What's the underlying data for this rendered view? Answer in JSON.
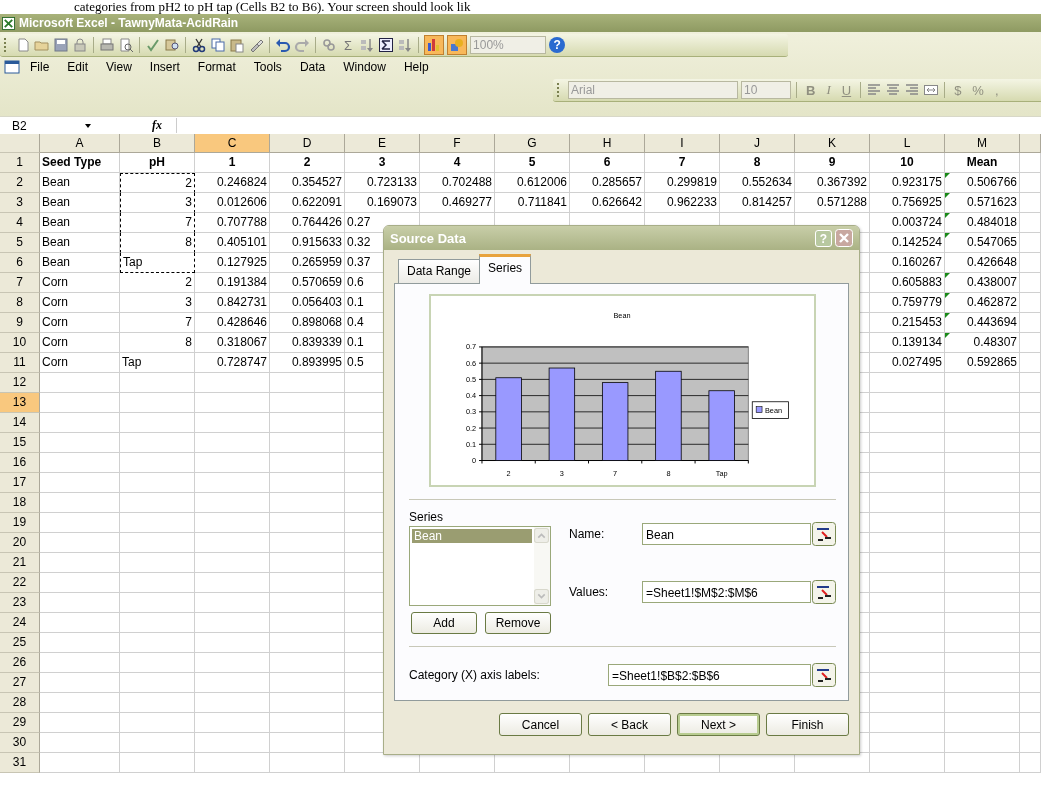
{
  "document_text": "categories from pH2 to pH tap (Cells B2 to B6). Your screen should look lik",
  "window": {
    "title": "Microsoft Excel - TawnyMata-AcidRain"
  },
  "toolbar": {
    "autosum": "Σ",
    "zoom": "100%",
    "help": "?"
  },
  "menu": [
    "File",
    "Edit",
    "View",
    "Insert",
    "Format",
    "Tools",
    "Data",
    "Window",
    "Help"
  ],
  "format_toolbar": {
    "font": "Arial",
    "size": "10",
    "styles": [
      "B",
      "I",
      "U"
    ],
    "number_formats": [
      "$",
      "%",
      ","
    ]
  },
  "formula_bar": {
    "name_box": "B2",
    "fx": "fx"
  },
  "sheet": {
    "columns": [
      {
        "label": "A",
        "selected": false
      },
      {
        "label": "B",
        "selected": false
      },
      {
        "label": "C",
        "selected": true
      },
      {
        "label": "D",
        "selected": false
      },
      {
        "label": "E",
        "selected": false
      },
      {
        "label": "F",
        "selected": false
      },
      {
        "label": "G",
        "selected": false
      },
      {
        "label": "H",
        "selected": false
      },
      {
        "label": "I",
        "selected": false
      },
      {
        "label": "J",
        "selected": false
      },
      {
        "label": "K",
        "selected": false
      },
      {
        "label": "L",
        "selected": false
      },
      {
        "label": "M",
        "selected": false
      }
    ],
    "rows": [
      {
        "number": "1",
        "selected": false,
        "kind": "header",
        "cells": [
          "Seed Type",
          "pH",
          "1",
          "2",
          "3",
          "4",
          "5",
          "6",
          "7",
          "8",
          "9",
          "10",
          "Mean"
        ]
      },
      {
        "number": "2",
        "selected": false,
        "kind": "data",
        "copy_range": true,
        "ph_is_text": false,
        "flag": true,
        "cells": [
          "Bean",
          "2",
          "0.246824",
          "0.354527",
          "0.723133",
          "0.702488",
          "0.612006",
          "0.285657",
          "0.299819",
          "0.552634",
          "0.367392",
          "0.923175",
          "0.506766"
        ]
      },
      {
        "number": "3",
        "selected": false,
        "kind": "data",
        "copy_range": true,
        "ph_is_text": false,
        "flag": true,
        "cells": [
          "Bean",
          "3",
          "0.012606",
          "0.622091",
          "0.169073",
          "0.469277",
          "0.711841",
          "0.626642",
          "0.962233",
          "0.814257",
          "0.571288",
          "0.756925",
          "0.571623"
        ]
      },
      {
        "number": "4",
        "selected": false,
        "kind": "data",
        "copy_range": true,
        "ph_is_text": false,
        "flag": true,
        "cells": [
          "Bean",
          "7",
          "0.707788",
          "0.764426",
          "0.27",
          null,
          null,
          null,
          null,
          null,
          null,
          "0.003724",
          "0.484018"
        ]
      },
      {
        "number": "5",
        "selected": false,
        "kind": "data",
        "copy_range": true,
        "ph_is_text": false,
        "flag": true,
        "cells": [
          "Bean",
          "8",
          "0.405101",
          "0.915633",
          "0.32",
          null,
          null,
          null,
          null,
          null,
          null,
          "0.142524",
          "0.547065"
        ]
      },
      {
        "number": "6",
        "selected": false,
        "kind": "data",
        "copy_range": true,
        "ph_is_text": true,
        "flag": false,
        "cells": [
          "Bean",
          "Tap",
          "0.127925",
          "0.265959",
          "0.37",
          null,
          null,
          null,
          null,
          null,
          null,
          "0.160267",
          "0.426648"
        ]
      },
      {
        "number": "7",
        "selected": false,
        "kind": "data",
        "copy_range": false,
        "ph_is_text": false,
        "flag": true,
        "cells": [
          "Corn",
          "2",
          "0.191384",
          "0.570659",
          "0.6",
          null,
          null,
          null,
          null,
          null,
          null,
          "0.605883",
          "0.438007"
        ]
      },
      {
        "number": "8",
        "selected": false,
        "kind": "data",
        "copy_range": false,
        "ph_is_text": false,
        "flag": true,
        "cells": [
          "Corn",
          "3",
          "0.842731",
          "0.056403",
          "0.1",
          null,
          null,
          null,
          null,
          null,
          null,
          "0.759779",
          "0.462872"
        ]
      },
      {
        "number": "9",
        "selected": false,
        "kind": "data",
        "copy_range": false,
        "ph_is_text": false,
        "flag": true,
        "cells": [
          "Corn",
          "7",
          "0.428646",
          "0.898068",
          "0.4",
          null,
          null,
          null,
          null,
          null,
          null,
          "0.215453",
          "0.443694"
        ]
      },
      {
        "number": "10",
        "selected": false,
        "kind": "data",
        "copy_range": false,
        "ph_is_text": false,
        "flag": true,
        "cells": [
          "Corn",
          "8",
          "0.318067",
          "0.839339",
          "0.1",
          null,
          null,
          null,
          null,
          null,
          null,
          "0.139134",
          "0.48307"
        ]
      },
      {
        "number": "11",
        "selected": false,
        "kind": "data",
        "copy_range": false,
        "ph_is_text": true,
        "flag": false,
        "cells": [
          "Corn",
          "Tap",
          "0.728747",
          "0.893995",
          "0.5",
          null,
          null,
          null,
          null,
          null,
          null,
          "0.027495",
          "0.592865"
        ]
      },
      {
        "number": "12",
        "selected": false
      },
      {
        "number": "13",
        "selected": true
      },
      {
        "number": "14",
        "selected": false
      },
      {
        "number": "15",
        "selected": false
      },
      {
        "number": "16",
        "selected": false
      },
      {
        "number": "17",
        "selected": false
      },
      {
        "number": "18",
        "selected": false
      },
      {
        "number": "19",
        "selected": false
      },
      {
        "number": "20",
        "selected": false
      },
      {
        "number": "21",
        "selected": false
      },
      {
        "number": "22",
        "selected": false
      },
      {
        "number": "23",
        "selected": false
      },
      {
        "number": "24",
        "selected": false
      },
      {
        "number": "25",
        "selected": false
      },
      {
        "number": "26",
        "selected": false
      },
      {
        "number": "27",
        "selected": false
      },
      {
        "number": "28",
        "selected": false
      },
      {
        "number": "29",
        "selected": false
      },
      {
        "number": "30",
        "selected": false
      },
      {
        "number": "31",
        "selected": false
      }
    ]
  },
  "dialog": {
    "title": "Source Data",
    "help": "?",
    "tabs": [
      {
        "label": "Data Range",
        "selected": false
      },
      {
        "label": "Series",
        "selected": true
      }
    ],
    "chart_data": {
      "type": "bar",
      "title": "Bean",
      "categories": [
        "2",
        "3",
        "7",
        "8",
        "Tap"
      ],
      "series": [
        {
          "name": "Bean",
          "color": "#9999ff",
          "values": [
            0.51,
            0.57,
            0.48,
            0.55,
            0.43
          ]
        }
      ],
      "grid": true,
      "ylim": [
        0,
        0.7
      ],
      "yticks": [
        0,
        0.1,
        0.2,
        0.3,
        0.4,
        0.5,
        0.6,
        0.7
      ]
    },
    "series_label": "Series",
    "series_list": [
      {
        "label": "Bean",
        "selected": true
      }
    ],
    "add_button": "Add",
    "remove_button": "Remove",
    "name": {
      "label": "Name:",
      "value": "Bean"
    },
    "values": {
      "label": "Values:",
      "value": "=Sheet1!$M$2:$M$6"
    },
    "category": {
      "label": "Category (X) axis labels:",
      "value": "=Sheet1!$B$2:$B$6"
    },
    "buttons": [
      {
        "label": "Cancel",
        "default": false
      },
      {
        "label": "< Back",
        "default": false
      },
      {
        "label": "Next >",
        "default": true
      },
      {
        "label": "Finish",
        "default": false
      }
    ]
  }
}
